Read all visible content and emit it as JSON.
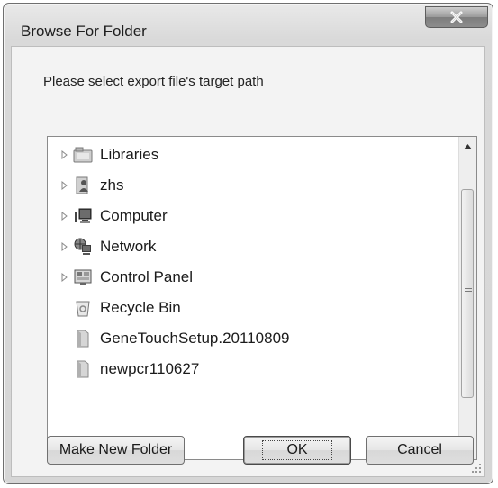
{
  "window": {
    "title": "Browse For Folder"
  },
  "prompt": "Please select export file's target path",
  "tree": {
    "items": [
      {
        "label": "Libraries",
        "icon": "libraries-icon",
        "expandable": true
      },
      {
        "label": "zhs",
        "icon": "user-folder-icon",
        "expandable": true
      },
      {
        "label": "Computer",
        "icon": "computer-icon",
        "expandable": true
      },
      {
        "label": "Network",
        "icon": "network-icon",
        "expandable": true
      },
      {
        "label": "Control Panel",
        "icon": "control-panel-icon",
        "expandable": true
      },
      {
        "label": "Recycle Bin",
        "icon": "recycle-bin-icon",
        "expandable": false
      },
      {
        "label": "GeneTouchSetup.20110809",
        "icon": "folder-icon",
        "expandable": false
      },
      {
        "label": "newpcr110627",
        "icon": "folder-icon",
        "expandable": false
      }
    ]
  },
  "buttons": {
    "make_new_folder": "Make New Folder",
    "ok": "OK",
    "cancel": "Cancel"
  }
}
